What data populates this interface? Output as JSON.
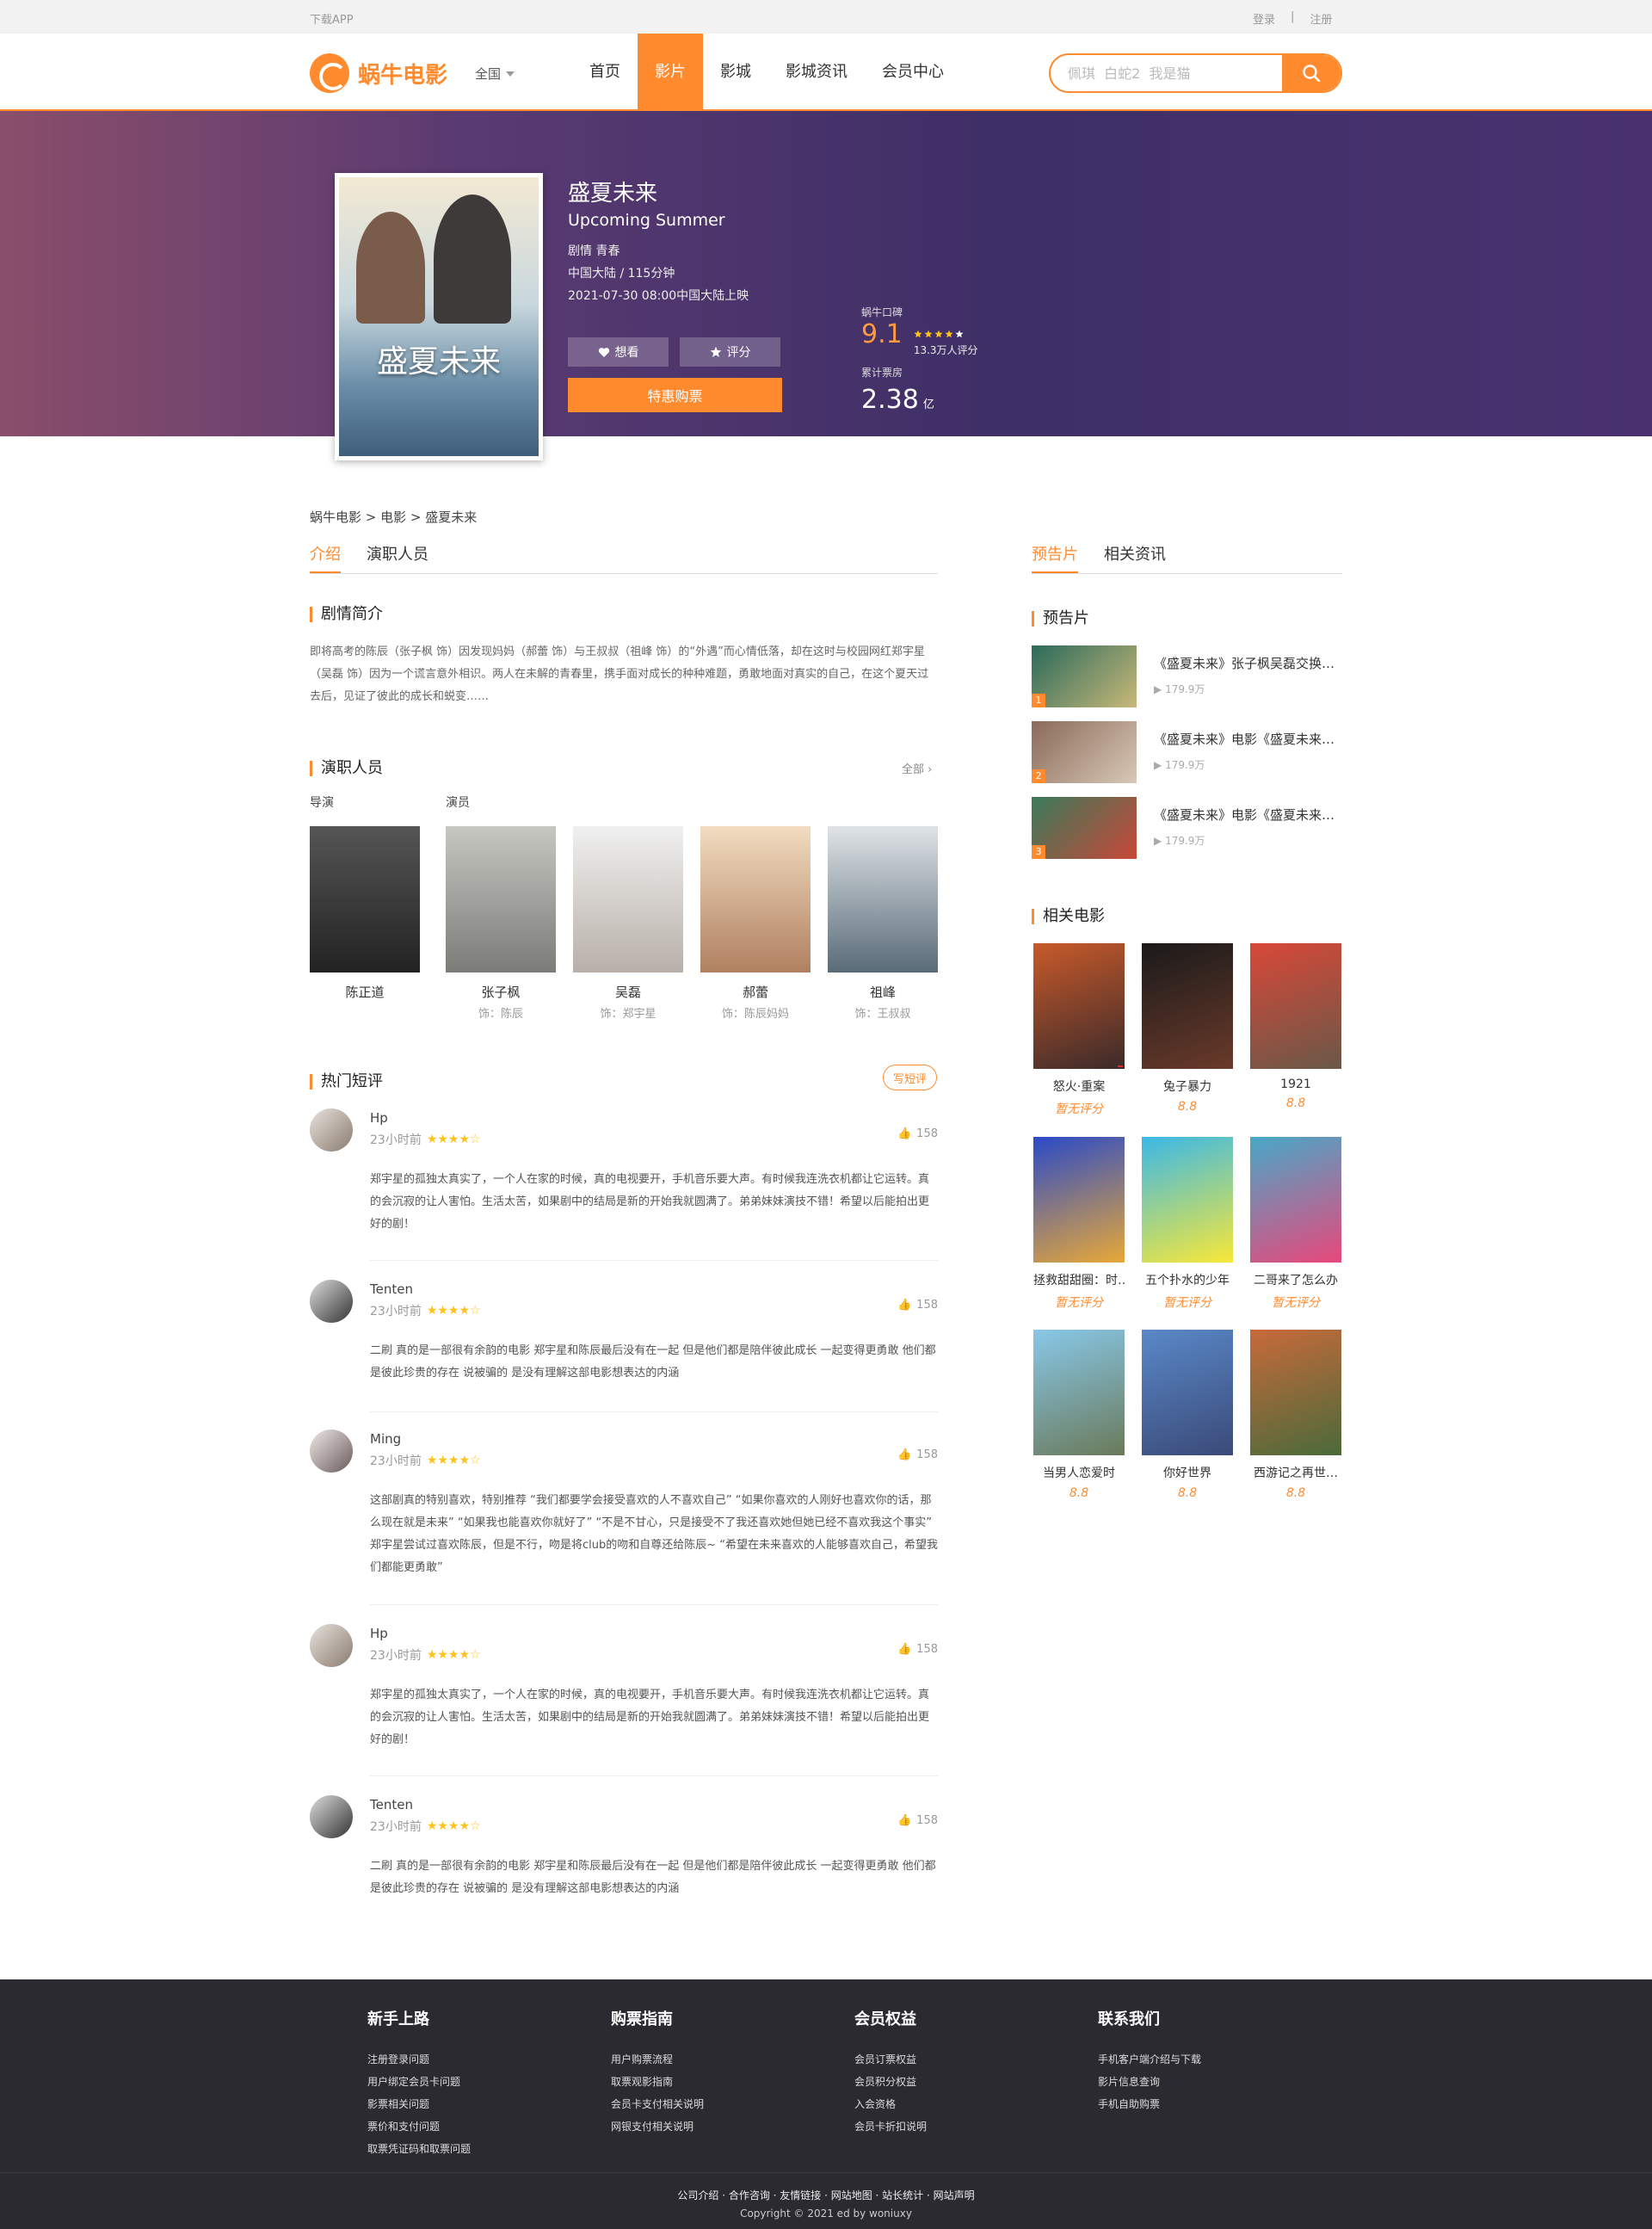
{
  "topbar": {
    "download": "下载APP",
    "login": "登录",
    "sep": "|",
    "register": "注册"
  },
  "header": {
    "logo": "蜗牛电影",
    "city": "全国",
    "nav": [
      "首页",
      "影片",
      "影城",
      "影城资讯",
      "会员中心"
    ],
    "search_placeholder": "佩琪  白蛇2  我是猫"
  },
  "movie": {
    "title": "盛夏未来",
    "title_en": "Upcoming Summer",
    "genre": "剧情 青春",
    "region_length": "中国大陆 / 115分钟",
    "release": "2021-07-30 08:00中国大陆上映",
    "poster_text": "盛夏未来",
    "want": "想看",
    "rate": "评分",
    "buy": "特惠购票",
    "score_label": "蜗牛口碑",
    "score": "9.1",
    "score_count": "13.3万人评分",
    "box_label": "累计票房",
    "box": "2.38",
    "box_unit": "亿"
  },
  "breadcrumb": "蜗牛电影 > 电影 > 盛夏未来",
  "tabs": {
    "intro": "介绍",
    "cast": "演职人员",
    "trailer": "预告片",
    "news": "相关资讯"
  },
  "synopsis": {
    "title": "剧情简介",
    "text": "即将高考的陈辰（张子枫 饰）因发现妈妈（郝蕾 饰）与王叔叔（祖峰 饰）的“外遇”而心情低落，却在这时与校园网红郑宇星（吴磊 饰）因为一个谎言意外相识。两人在未解的青春里，携手面对成长的种种难题，勇敢地面对真实的自己，在这个夏天过去后，见证了彼此的成长和蜕变……"
  },
  "cast": {
    "title": "演职人员",
    "more": "全部",
    "director_label": "导演",
    "actor_label": "演员",
    "people": [
      {
        "name": "陈正道",
        "role": ""
      },
      {
        "name": "张子枫",
        "role": "饰：陈辰"
      },
      {
        "name": "吴磊",
        "role": "饰：郑宇星"
      },
      {
        "name": "郝蕾",
        "role": "饰：陈辰妈妈"
      },
      {
        "name": "祖峰",
        "role": "饰：王叔叔"
      }
    ]
  },
  "reviews": {
    "title": "热门短评",
    "write": "写短评",
    "items": [
      {
        "user": "Hp",
        "time": "23小时前",
        "likes": "158",
        "text": "郑宇星的孤独太真实了，一个人在家的时候，真的电视要开，手机音乐要大声。有时候我连洗衣机都让它运转。真的会沉寂的让人害怕。生活太苦，如果剧中的结局是新的开始我就圆满了。弟弟妹妹演技不错！希望以后能拍出更好的剧！"
      },
      {
        "user": "Tenten",
        "time": "23小时前",
        "likes": "158",
        "text": "二刷 真的是一部很有余韵的电影 郑宇星和陈辰最后没有在一起 但是他们都是陪伴彼此成长 一起变得更勇敢 他们都是彼此珍贵的存在 说被骗的 是没有理解这部电影想表达的内涵"
      },
      {
        "user": "Ming",
        "time": "23小时前",
        "likes": "158",
        "text": "这部剧真的特别喜欢，特别推荐 “我们都要学会接受喜欢的人不喜欢自己” “如果你喜欢的人刚好也喜欢你的话，那么现在就是未来” “如果我也能喜欢你就好了” “不是不甘心，只是接受不了我还喜欢她但她已经不喜欢我这个事实” 郑宇星尝试过喜欢陈辰，但是不行，吻是将club的吻和自尊还给陈辰~ “希望在未来喜欢的人能够喜欢自己，希望我们都能更勇敢”"
      },
      {
        "user": "Hp",
        "time": "23小时前",
        "likes": "158",
        "text": "郑宇星的孤独太真实了，一个人在家的时候，真的电视要开，手机音乐要大声。有时候我连洗衣机都让它运转。真的会沉寂的让人害怕。生活太苦，如果剧中的结局是新的开始我就圆满了。弟弟妹妹演技不错！希望以后能拍出更好的剧！"
      },
      {
        "user": "Tenten",
        "time": "23小时前",
        "likes": "158",
        "text": "二刷 真的是一部很有余韵的电影 郑宇星和陈辰最后没有在一起 但是他们都是陪伴彼此成长 一起变得更勇敢 他们都是彼此珍贵的存在 说被骗的 是没有理解这部电影想表达的内涵"
      }
    ]
  },
  "trailers": {
    "title": "预告片",
    "items": [
      {
        "num": "1",
        "title": "《盛夏未来》张子枫吴磊交换…",
        "views": "179.9万"
      },
      {
        "num": "2",
        "title": "《盛夏未来》电影《盛夏未来…",
        "views": "179.9万"
      },
      {
        "num": "3",
        "title": "《盛夏未来》电影《盛夏未来…",
        "views": "179.9万"
      }
    ]
  },
  "related": {
    "title": "相关电影",
    "items": [
      {
        "name": "怒火·重案",
        "score": "暂无评分"
      },
      {
        "name": "兔子暴力",
        "score": "8.8"
      },
      {
        "name": "1921",
        "score": "8.8"
      },
      {
        "name": "拯救甜甜圈：时…",
        "score": "暂无评分"
      },
      {
        "name": "五个扑水的少年",
        "score": "暂无评分"
      },
      {
        "name": "二哥来了怎么办",
        "score": "暂无评分"
      },
      {
        "name": "当男人恋爱时",
        "score": "8.8"
      },
      {
        "name": "你好世界",
        "score": "8.8"
      },
      {
        "name": "西游记之再世…",
        "score": "8.8"
      }
    ]
  },
  "footer": {
    "cols": [
      {
        "title": "新手上路",
        "links": [
          "注册登录问题",
          "用户绑定会员卡问题",
          "影票相关问题",
          "票价和支付问题",
          "取票凭证码和取票问题"
        ]
      },
      {
        "title": "购票指南",
        "links": [
          "用户购票流程",
          "取票观影指南",
          "会员卡支付相关说明",
          "网银支付相关说明"
        ]
      },
      {
        "title": "会员权益",
        "links": [
          "会员订票权益",
          "会员积分权益",
          "入会资格",
          "会员卡折扣说明"
        ]
      },
      {
        "title": "联系我们",
        "links": [
          "手机客户端介绍与下载",
          "影片信息查询",
          "手机自助购票"
        ]
      }
    ],
    "links": "公司介绍 · 合作咨询 · 友情链接 · 网站地图 · 站长统计 · 网站声明",
    "copyright": "Copyright © 2021 ed by woniuxy"
  },
  "colors": {
    "accent": "#ff8b2e",
    "footer_bg": "#2b2a30"
  }
}
